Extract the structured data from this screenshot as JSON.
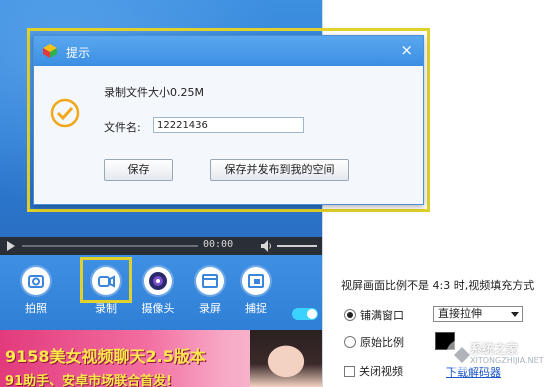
{
  "dialog": {
    "title": "提示",
    "close_glyph": "×",
    "size_text": "录制文件大小0.25M",
    "filename_label": "文件名:",
    "filename_value": "12221436",
    "save_button": "保存",
    "save_publish_button": "保存并发布到我的空间"
  },
  "player": {
    "time": "00:00"
  },
  "toolbar": {
    "items": [
      {
        "label": "拍照",
        "icon": "camera-icon"
      },
      {
        "label": "录制",
        "icon": "video-record-icon"
      },
      {
        "label": "摄像头",
        "icon": "webcam-icon"
      },
      {
        "label": "录屏",
        "icon": "screen-record-icon"
      },
      {
        "label": "捕捉",
        "icon": "capture-icon"
      }
    ]
  },
  "ad": {
    "title": "9158美女视频聊天2.5版本",
    "subtitle": "91助手、安卓市场联合首发!"
  },
  "settings": {
    "aspect_note": "视屏画面比例不是 4:3 时,视频填充方式",
    "fill_window_label": "铺满窗口",
    "stretch_option": "直接拉伸",
    "original_ratio_label": "原始比例",
    "close_label": "关闭视频",
    "download_decoder_link": "下载解码器"
  },
  "watermark": {
    "text": "系统之家",
    "url": "XITONGZHIJIA.NET"
  },
  "colors": {
    "highlight_frame": "#e2d12a",
    "titlebar": "#3b8fe3",
    "app_blue": "#2f7fd6"
  }
}
